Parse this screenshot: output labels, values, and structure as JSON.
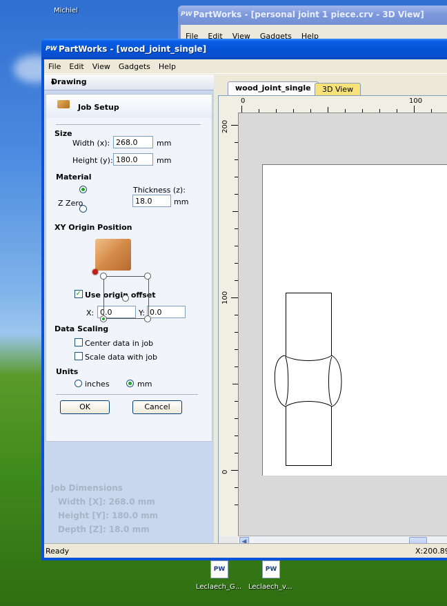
{
  "desktop": {
    "user_label": "Michiel",
    "icons": [
      {
        "logo": "PW",
        "label": "Leclaech_G..."
      },
      {
        "logo": "PW",
        "label": "Leclaech_v..."
      }
    ]
  },
  "back_window": {
    "logo": "PW",
    "title": "PartWorks - [personal joint 1 piece.crv - 3D View]",
    "menu": [
      "File",
      "Edit",
      "View",
      "Gadgets",
      "Help"
    ]
  },
  "main_window": {
    "logo": "PW",
    "title": "PartWorks - [wood_joint_single]",
    "menu": [
      "File",
      "Edit",
      "View",
      "Gadgets",
      "Help"
    ]
  },
  "panel": {
    "header": "Drawing",
    "pin_glyph": "⬧",
    "job_setup_label": "Job Setup",
    "size": {
      "label": "Size",
      "width_label": "Width (x):",
      "width_value": "268.0",
      "height_label": "Height (y):",
      "height_value": "180.0",
      "unit": "mm"
    },
    "material": {
      "label": "Material",
      "z_zero_label": "Z Zero",
      "thickness_label": "Thickness (z):",
      "thickness_value": "18.0",
      "unit": "mm"
    },
    "xy_origin": {
      "label": "XY Origin Position",
      "use_offset_label": "Use origin offset",
      "use_offset_checked": true,
      "x_label": "X:",
      "x_value": "0.0",
      "y_label": "Y:",
      "y_value": "0.0"
    },
    "scaling": {
      "label": "Data Scaling",
      "center_label": "Center data in job",
      "scale_label": "Scale data with job"
    },
    "units": {
      "label": "Units",
      "inches_label": "inches",
      "mm_label": "mm",
      "selected": "mm"
    },
    "ok_label": "OK",
    "cancel_label": "Cancel",
    "job_dimensions": {
      "title": "Job Dimensions",
      "width": "Width  [X]: 268.0 mm",
      "height": "Height [Y]: 180.0 mm",
      "depth": "Depth  [Z]: 18.0 mm"
    }
  },
  "view": {
    "tabs": [
      "wood_joint_single",
      "3D View"
    ],
    "ruler_h": [
      "0",
      "100"
    ],
    "ruler_v": [
      "200",
      "100",
      "0"
    ]
  },
  "status": {
    "left": "Ready",
    "right": "X:200.89"
  }
}
